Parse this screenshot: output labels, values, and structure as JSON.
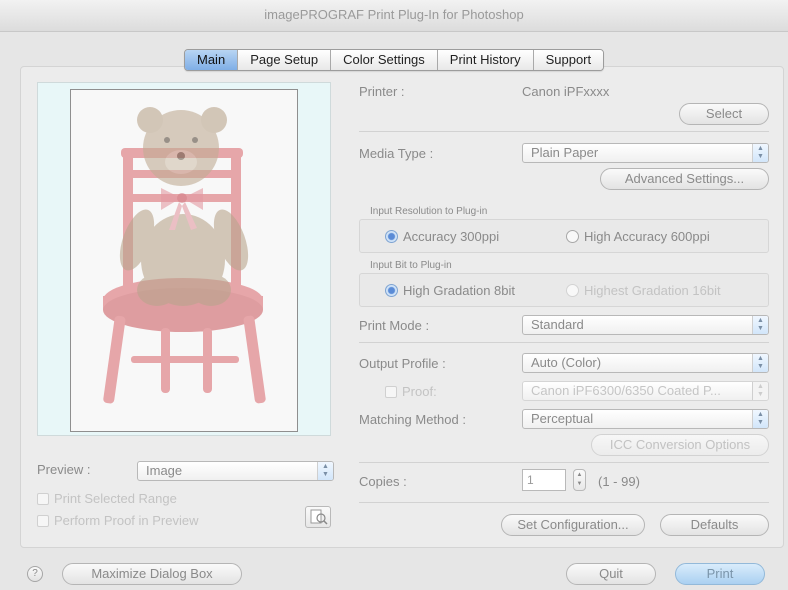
{
  "window": {
    "title": "imagePROGRAF Print Plug-In for Photoshop"
  },
  "tabs": [
    {
      "label": "Main",
      "active": true
    },
    {
      "label": "Page Setup",
      "active": false
    },
    {
      "label": "Color Settings",
      "active": false
    },
    {
      "label": "Print History",
      "active": false
    },
    {
      "label": "Support",
      "active": false
    }
  ],
  "printer": {
    "label": "Printer :",
    "value": "Canon iPFxxxx",
    "select_button": "Select"
  },
  "media_type": {
    "label": "Media Type :",
    "value": "Plain Paper",
    "advanced_button": "Advanced Settings..."
  },
  "input_resolution": {
    "title": "Input Resolution to Plug-in",
    "options": [
      {
        "label": "Accuracy 300ppi",
        "selected": true
      },
      {
        "label": "High Accuracy 600ppi",
        "selected": false
      }
    ]
  },
  "input_bit": {
    "title": "Input Bit to Plug-in",
    "options": [
      {
        "label": "High Gradation 8bit",
        "selected": true
      },
      {
        "label": "Highest Gradation 16bit",
        "selected": false,
        "disabled": true
      }
    ]
  },
  "print_mode": {
    "label": "Print Mode :",
    "value": "Standard"
  },
  "output_profile": {
    "label": "Output Profile :",
    "value": "Auto (Color)"
  },
  "proof": {
    "label": "Proof:",
    "value": "Canon iPF6300/6350 Coated P...",
    "checked": false
  },
  "matching_method": {
    "label": "Matching Method :",
    "value": "Perceptual",
    "icc_button": "ICC Conversion Options"
  },
  "copies": {
    "label": "Copies :",
    "value": "1",
    "range": "(1 - 99)"
  },
  "set_configuration_button": "Set Configuration...",
  "defaults_button": "Defaults",
  "preview": {
    "label": "Preview :",
    "mode": "Image",
    "print_selected_range": "Print Selected Range",
    "perform_proof": "Perform Proof in Preview"
  },
  "footer": {
    "maximize_button": "Maximize Dialog Box",
    "quit_button": "Quit",
    "print_button": "Print"
  },
  "colors": {
    "accent": "#7faee6",
    "chair": "#d9646a",
    "bear": "#b9a58d"
  },
  "icons": {
    "help": "question-circle-icon",
    "proof": "proof-preview-icon"
  }
}
